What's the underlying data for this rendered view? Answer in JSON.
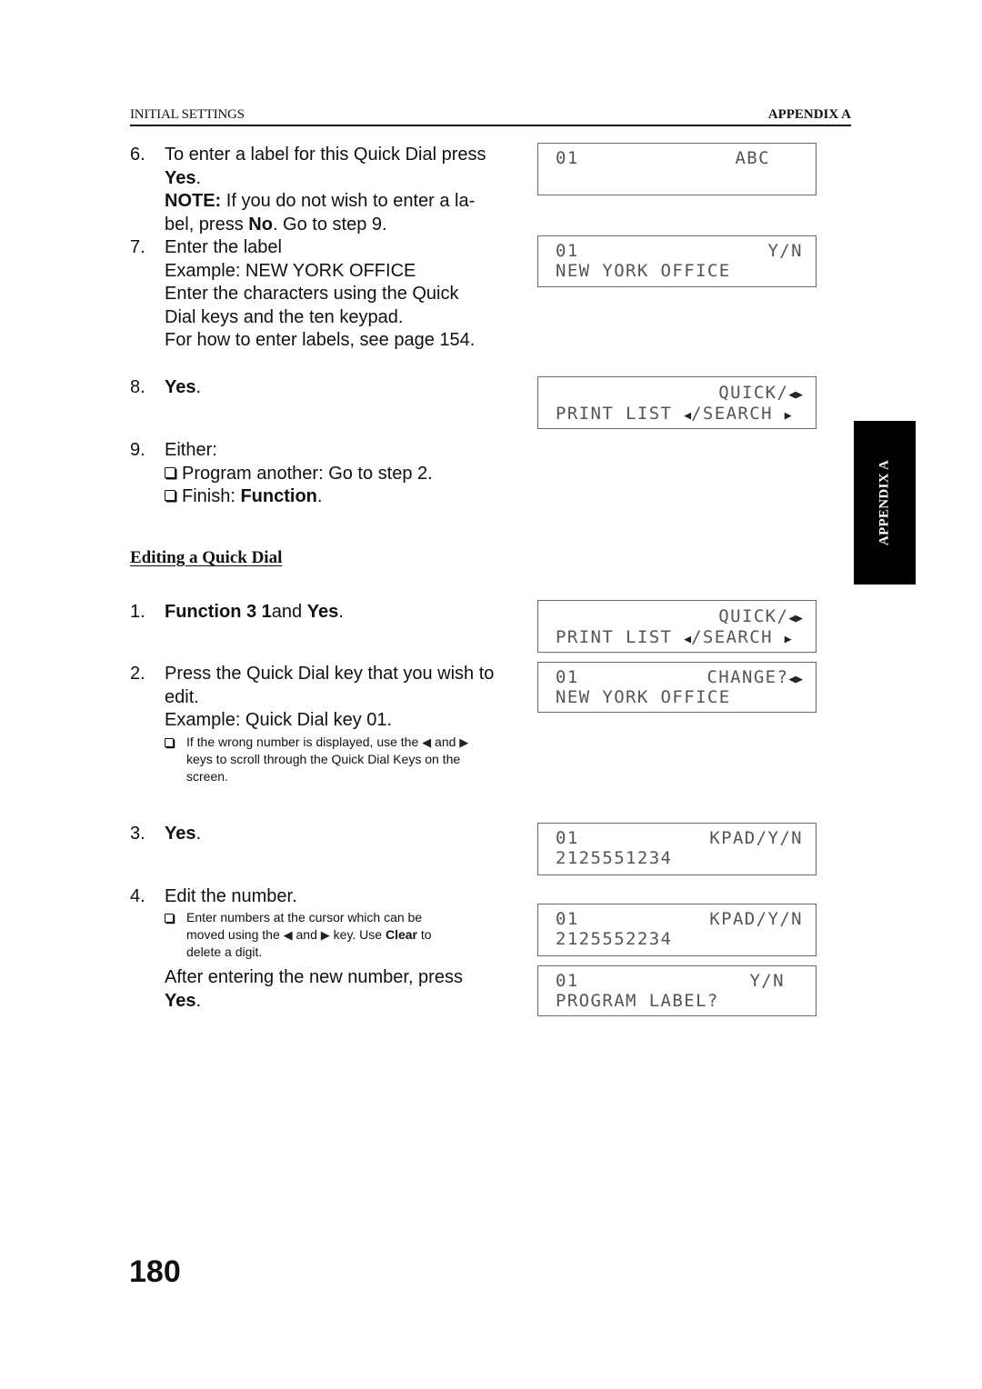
{
  "header": {
    "left": "INITIAL SETTINGS",
    "right": "APPENDIX A"
  },
  "side_tab": "APPENDIX A",
  "page_number": "180",
  "steps_top": {
    "step6": {
      "num": "6.",
      "text": "To enter a label for this Quick Dial press",
      "bold_key": "Yes",
      "note_label": "NOTE:",
      "note_text_a": " If you do not wish to enter a la-",
      "note_text_b": "bel, press ",
      "note_key": "No",
      "note_text_c": ". Go to step 9."
    },
    "step7": {
      "num": "7.",
      "line1": "Enter the label",
      "line2": "Example: NEW YORK OFFICE",
      "line3": "Enter the characters using the Quick",
      "line4": "Dial keys and the ten keypad.",
      "line5": "For how to enter labels, see page 154."
    },
    "step8": {
      "num": "8.",
      "key": "Yes",
      "suffix": "."
    },
    "step9": {
      "num": "9.",
      "text": "Either:",
      "option1": "Program another: Go to step 2.",
      "option2_prefix": "Finish: ",
      "option2_key": "Function",
      "option2_suffix": "."
    }
  },
  "section_title": "Editing a Quick Dial",
  "steps_edit": {
    "step1": {
      "num": "1.",
      "key1": "Function 3 1",
      "mid": "and ",
      "key2": "Yes",
      "suffix": "."
    },
    "step2": {
      "num": "2.",
      "line1": "Press the Quick Dial key that you wish to",
      "line2": "edit.",
      "line3": "Example: Quick Dial key 01.",
      "note_a": "If the wrong number is displayed, use the",
      "note_b": "and",
      "note_c": "keys to scroll through the Quick Dial Keys on the",
      "note_d": "screen."
    },
    "step3": {
      "num": "3.",
      "key": "Yes",
      "suffix": "."
    },
    "step4": {
      "num": "4.",
      "text": "Edit the number.",
      "note_a": "Enter numbers at the cursor which can be",
      "note_b": "moved using the",
      "note_c": "and",
      "note_d": "key.  Use",
      "note_key": "Clear",
      "note_e": "to",
      "note_f": "delete a digit.",
      "after_a": "After entering the new number, press",
      "after_key": "Yes",
      "after_suffix": "."
    }
  },
  "lcd_displays": [
    {
      "line1_left": "01",
      "line1_right": "ABC",
      "line2": ""
    },
    {
      "line1_left": "01",
      "line1_right": "Y/N",
      "line2": "NEW YORK OFFICE"
    },
    {
      "line1_right": "QUICK/",
      "line2_left": "PRINT LIST ",
      "line2_mid": "/SEARCH "
    },
    {
      "line1_right": "QUICK/",
      "line2_left": "PRINT LIST ",
      "line2_mid": "/SEARCH "
    },
    {
      "line1_left": "01",
      "line1_right": "CHANGE?",
      "line2": "NEW YORK OFFICE"
    },
    {
      "line1_left": "01",
      "line1_right": "KPAD/Y/N",
      "line2": "2125551234"
    },
    {
      "line1_left": "01",
      "line1_right": "KPAD/Y/N",
      "line2": "2125552234"
    },
    {
      "line1_left": "01",
      "line1_right": "Y/N",
      "line2": "PROGRAM LABEL?"
    }
  ],
  "icons": {
    "left_arrow": "◀",
    "right_arrow": "▶"
  }
}
